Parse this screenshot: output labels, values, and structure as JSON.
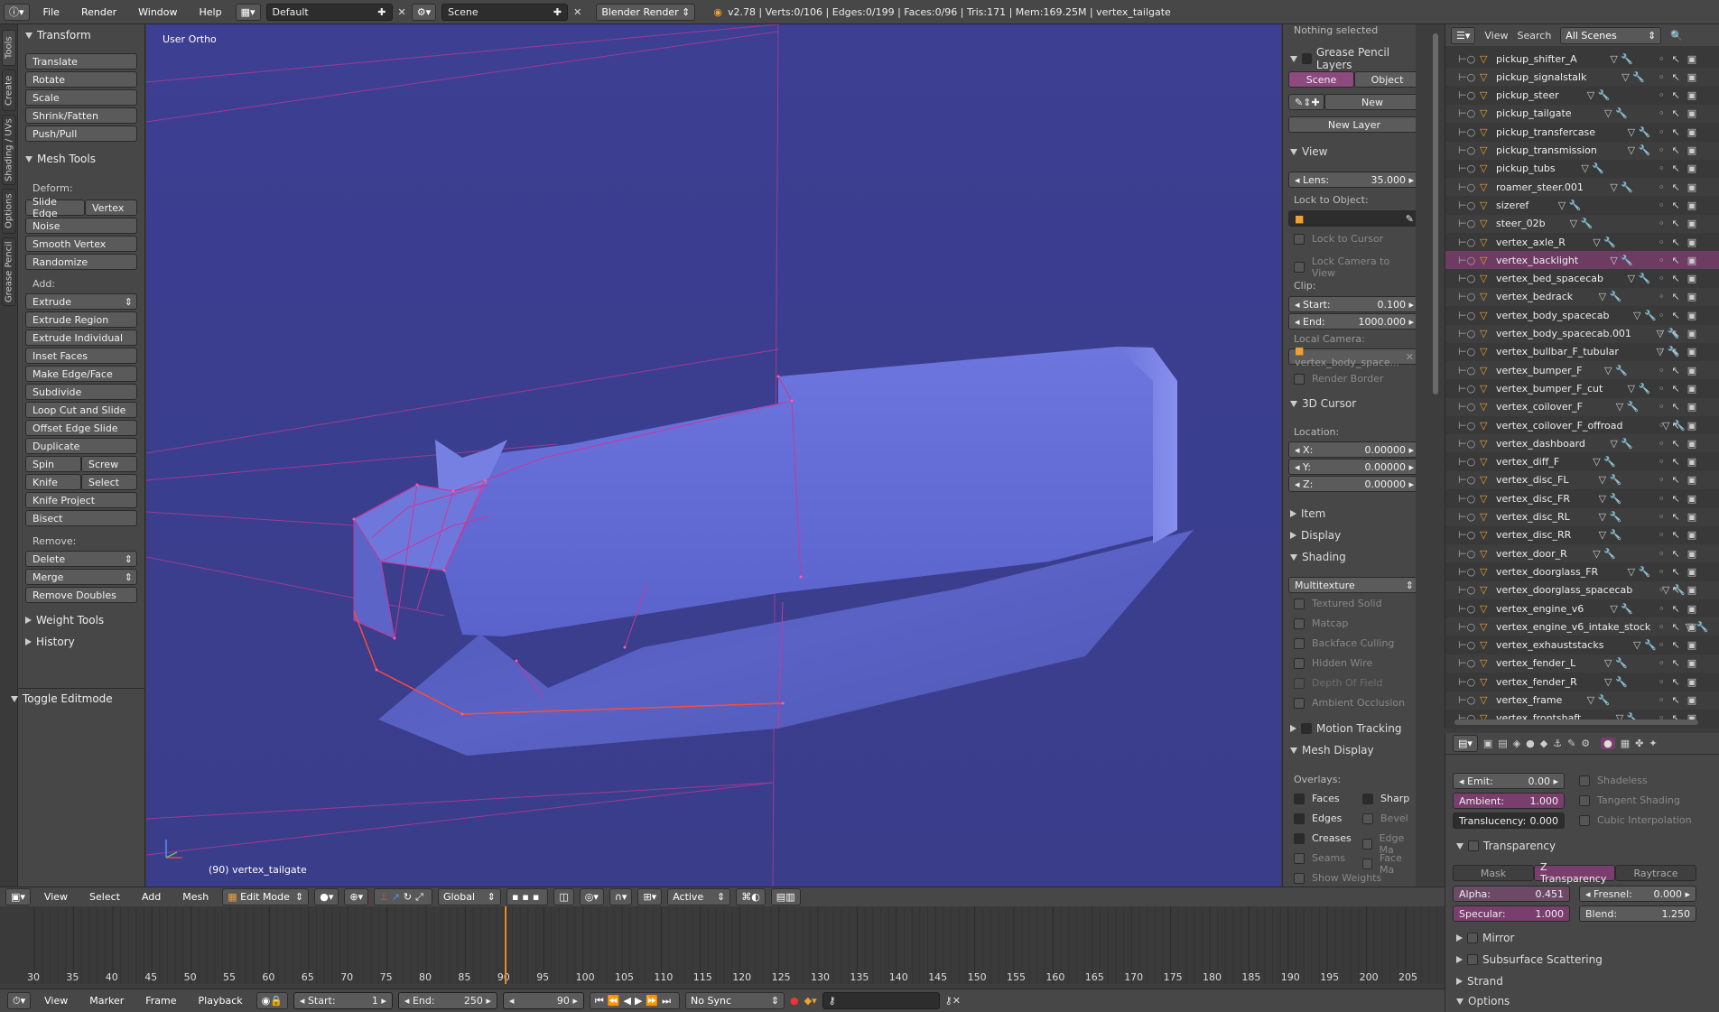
{
  "topbar": {
    "menus": [
      "File",
      "Render",
      "Window",
      "Help"
    ],
    "screen_layout": "Default",
    "scene": "Scene",
    "engine": "Blender Render",
    "status": "v2.78 | Verts:0/106 | Edges:0/199 | Faces:0/96 | Tris:171 | Mem:169.25M | vertex_tailgate"
  },
  "vtabs": [
    "Tools",
    "Create",
    "Shading / UVs",
    "Options",
    "Grease Pencil"
  ],
  "toolshelf": {
    "transform": {
      "title": "Transform",
      "buttons": [
        "Translate",
        "Rotate",
        "Scale",
        "Shrink/Fatten",
        "Push/Pull"
      ]
    },
    "mesh_tools": {
      "title": "Mesh Tools",
      "deform_label": "Deform:",
      "slide_edge": "Slide Edge",
      "vertex": "Vertex",
      "deform": [
        "Noise",
        "Smooth Vertex",
        "Randomize"
      ],
      "add_label": "Add:",
      "extrude": "Extrude",
      "add": [
        "Extrude Region",
        "Extrude Individual",
        "Inset Faces",
        "Make Edge/Face",
        "Subdivide",
        "Loop Cut and Slide",
        "Offset Edge Slide",
        "Duplicate"
      ],
      "spin": "Spin",
      "screw": "Screw",
      "knife": "Knife",
      "select": "Select",
      "knife_project": "Knife Project",
      "bisect": "Bisect",
      "remove_label": "Remove:",
      "delete": "Delete",
      "merge": "Merge",
      "remove_doubles": "Remove Doubles"
    },
    "weight_tools": "Weight Tools",
    "history": "History",
    "toggle_editmode": "Toggle Editmode"
  },
  "viewport": {
    "view_name": "User Ortho",
    "object_label": "(90) vertex_tailgate"
  },
  "npanel": {
    "nothing_selected": "Nothing selected",
    "grease_pencil_layers": "Grease Pencil Layers",
    "scene_tab": "Scene",
    "object_tab": "Object",
    "new": "New",
    "new_layer": "New Layer",
    "view": "View",
    "lens_label": "Lens:",
    "lens_value": "35.000",
    "lock_to_object": "Lock to Object:",
    "lock_to_cursor": "Lock to Cursor",
    "lock_camera": "Lock Camera to View",
    "clip": "Clip:",
    "start_label": "Start:",
    "start_value": "0.100",
    "end_label": "End:",
    "end_value": "1000.000",
    "local_camera": "Local Camera:",
    "local_camera_value": "vertex_body_space...",
    "render_border": "Render Border",
    "cursor3d": "3D Cursor",
    "location": "Location:",
    "x_label": "X:",
    "x_value": "0.00000",
    "y_label": "Y:",
    "y_value": "0.00000",
    "z_label": "Z:",
    "z_value": "0.00000",
    "item": "Item",
    "display": "Display",
    "shading": "Shading",
    "shading_mode": "Multitexture",
    "shading_opts": [
      "Textured Solid",
      "Matcap",
      "Backface Culling",
      "Hidden Wire",
      "Depth Of Field",
      "Ambient Occlusion"
    ],
    "motion_tracking": "Motion Tracking",
    "mesh_display": "Mesh Display",
    "overlays": "Overlays:",
    "overlay_left": [
      "Faces",
      "Edges",
      "Creases",
      "Seams",
      "Show Weights"
    ],
    "overlay_right": [
      "Sharp",
      "Bevel",
      "Edge Ma",
      "Face Ma"
    ]
  },
  "outliner": {
    "view": "View",
    "search": "Search",
    "scope": "All Scenes",
    "items": [
      "pickup_shifter_A",
      "pickup_signalstalk",
      "pickup_steer",
      "pickup_tailgate",
      "pickup_transfercase",
      "pickup_transmission",
      "pickup_tubs",
      "roamer_steer.001",
      "sizeref",
      "steer_02b",
      "vertex_axle_R",
      "vertex_backlight",
      "vertex_bed_spacecab",
      "vertex_bedrack",
      "vertex_body_spacecab",
      "vertex_body_spacecab.001",
      "vertex_bullbar_F_tubular",
      "vertex_bumper_F",
      "vertex_bumper_F_cut",
      "vertex_coilover_F",
      "vertex_coilover_F_offroad",
      "vertex_dashboard",
      "vertex_diff_F",
      "vertex_disc_FL",
      "vertex_disc_FR",
      "vertex_disc_RL",
      "vertex_disc_RR",
      "vertex_door_R",
      "vertex_doorglass_FR",
      "vertex_doorglass_spacecab",
      "vertex_engine_v6",
      "vertex_engine_v6_intake_stock",
      "vertex_exhauststacks",
      "vertex_fender_L",
      "vertex_fender_R",
      "vertex_frame",
      "vertex_frontshaft"
    ],
    "selected": "vertex_backlight"
  },
  "props": {
    "emit_label": "Emit:",
    "emit": "0.00",
    "shadeless": "Shadeless",
    "ambient_label": "Ambient:",
    "ambient": "1.000",
    "tangent": "Tangent Shading",
    "translucency_label": "Translucency:",
    "translucency": "0.000",
    "cubic": "Cubic Interpolation",
    "transparency": "Transparency",
    "mask": "Mask",
    "ztrans": "Z Transparency",
    "raytrace": "Raytrace",
    "alpha_label": "Alpha:",
    "alpha": "0.451",
    "fresnel_label": "Fresnel:",
    "fresnel": "0.000",
    "specular_label": "Specular:",
    "specular": "1.000",
    "blend_label": "Blend:",
    "blend": "1.250",
    "mirror": "Mirror",
    "sss": "Subsurface Scattering",
    "strand": "Strand",
    "options": "Options"
  },
  "vheader": {
    "menus": [
      "View",
      "Select",
      "Add",
      "Mesh"
    ],
    "mode": "Edit Mode",
    "orientation": "Global",
    "pivot": "Active"
  },
  "timeline": {
    "ticks": [
      "30",
      "35",
      "40",
      "45",
      "50",
      "55",
      "60",
      "65",
      "70",
      "75",
      "80",
      "85",
      "90",
      "95",
      "100",
      "105",
      "110",
      "115",
      "120",
      "125",
      "130",
      "135",
      "140",
      "145",
      "150",
      "155",
      "160",
      "165",
      "170",
      "175",
      "180",
      "185",
      "190",
      "195",
      "200",
      "205"
    ],
    "current": 90
  },
  "tlheader": {
    "menus": [
      "View",
      "Marker",
      "Frame",
      "Playback"
    ],
    "start_label": "Start:",
    "start": "1",
    "end_label": "End:",
    "end": "250",
    "current": "90",
    "sync": "No Sync"
  },
  "colors": {
    "accent": "#7a3e6e",
    "selected_btn": "#8c4a7f",
    "wire": "#d03c9a",
    "mesh": "#5a62cc",
    "frame_marker": "#f08a2a"
  }
}
